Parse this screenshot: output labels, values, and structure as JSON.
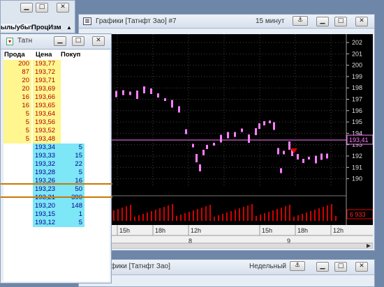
{
  "top_header": {
    "col1": "ыль/убыт",
    "col2": "ПроцИзм"
  },
  "chart_window": {
    "title": "Графики [Татнфт Зао] #7",
    "timeframe": "15 минут",
    "price_axis": [
      "202",
      "201",
      "200",
      "199",
      "198",
      "197",
      "196",
      "195",
      "194",
      "193",
      "192",
      "191",
      "190"
    ],
    "last_price": "193,41",
    "volume_label": "6 933",
    "time_labels": [
      "15h",
      "18h",
      "12h",
      "15h",
      "18h",
      "12h"
    ],
    "date_labels": [
      "8",
      "9"
    ]
  },
  "book_window": {
    "title": "Татн",
    "headers": {
      "sell": "Прода",
      "price": "Цена",
      "buy": "Покуп"
    },
    "asks": [
      {
        "qty": "200",
        "price": "193,77"
      },
      {
        "qty": "87",
        "price": "193,72"
      },
      {
        "qty": "20",
        "price": "193,71"
      },
      {
        "qty": "20",
        "price": "193,69"
      },
      {
        "qty": "16",
        "price": "193,66"
      },
      {
        "qty": "16",
        "price": "193,65"
      },
      {
        "qty": "5",
        "price": "193,64"
      },
      {
        "qty": "5",
        "price": "193,56"
      },
      {
        "qty": "5",
        "price": "193,52"
      },
      {
        "qty": "5",
        "price": "193,48"
      }
    ],
    "bids": [
      {
        "price": "193,34",
        "qty": "5"
      },
      {
        "price": "193,33",
        "qty": "15"
      },
      {
        "price": "193,32",
        "qty": "22"
      },
      {
        "price": "193,28",
        "qty": "5"
      },
      {
        "price": "193,26",
        "qty": "16"
      },
      {
        "price": "193,23",
        "qty": "50"
      },
      {
        "price": "193,21",
        "qty": "390"
      },
      {
        "price": "193,20",
        "qty": "148"
      },
      {
        "price": "193,15",
        "qty": "1"
      },
      {
        "price": "193,12",
        "qty": "5"
      }
    ]
  },
  "bottom_window": {
    "title": "рафики [Татнфт Зао]",
    "timeframe": "Недельный"
  },
  "colors": {
    "ask_bg": "#fff68f",
    "ask_text": "#b00000",
    "bid_bg": "#7de6f7",
    "bid_text": "#00008f",
    "candle": "#ff7eff",
    "chart_bg": "#000000"
  }
}
